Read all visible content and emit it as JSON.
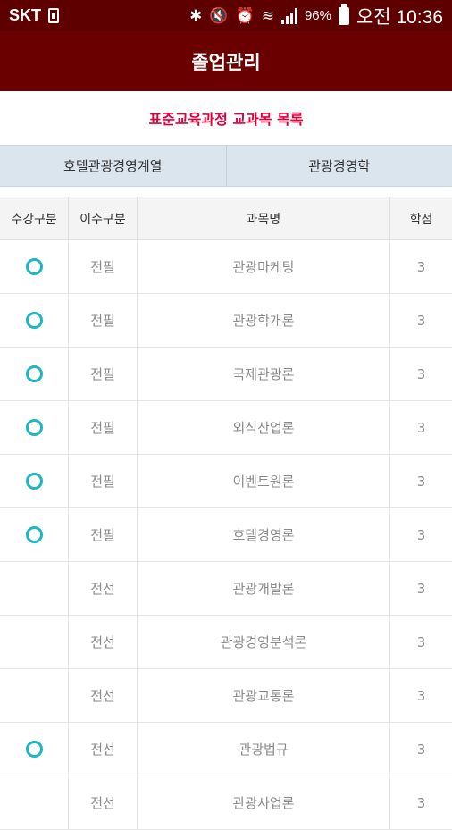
{
  "status_bar": {
    "carrier": "SKT",
    "battery": "96%",
    "clock": "오전 10:36",
    "icons": [
      "sim-icon",
      "bluetooth-icon",
      "mute-icon",
      "alarm-icon",
      "wifi-icon",
      "signal-icon",
      "battery-icon"
    ]
  },
  "header": {
    "title": "졸업관리"
  },
  "list_title": "표준교육과정 교과목 목록",
  "category": {
    "left": "호텔관광경영계열",
    "right": "관광경영학"
  },
  "table": {
    "columns": [
      "수강구분",
      "이수구분",
      "과목명",
      "학점"
    ],
    "rows": [
      {
        "taken": true,
        "type": "전필",
        "name": "관광마케팅",
        "credit": "3"
      },
      {
        "taken": true,
        "type": "전필",
        "name": "관광학개론",
        "credit": "3"
      },
      {
        "taken": true,
        "type": "전필",
        "name": "국제관광론",
        "credit": "3"
      },
      {
        "taken": true,
        "type": "전필",
        "name": "외식산업론",
        "credit": "3"
      },
      {
        "taken": true,
        "type": "전필",
        "name": "이벤트원론",
        "credit": "3"
      },
      {
        "taken": true,
        "type": "전필",
        "name": "호텔경영론",
        "credit": "3"
      },
      {
        "taken": false,
        "type": "전선",
        "name": "관광개발론",
        "credit": "3"
      },
      {
        "taken": false,
        "type": "전선",
        "name": "관광경영분석론",
        "credit": "3"
      },
      {
        "taken": false,
        "type": "전선",
        "name": "관광교통론",
        "credit": "3"
      },
      {
        "taken": true,
        "type": "전선",
        "name": "관광법규",
        "credit": "3"
      },
      {
        "taken": false,
        "type": "전선",
        "name": "관광사업론",
        "credit": "3"
      }
    ]
  },
  "colors": {
    "header": "#6b0000",
    "status_bar": "#5e0000",
    "accent": "#e0003a",
    "circle": "#1eb5c4",
    "category_bg": "#dbe5ee"
  }
}
